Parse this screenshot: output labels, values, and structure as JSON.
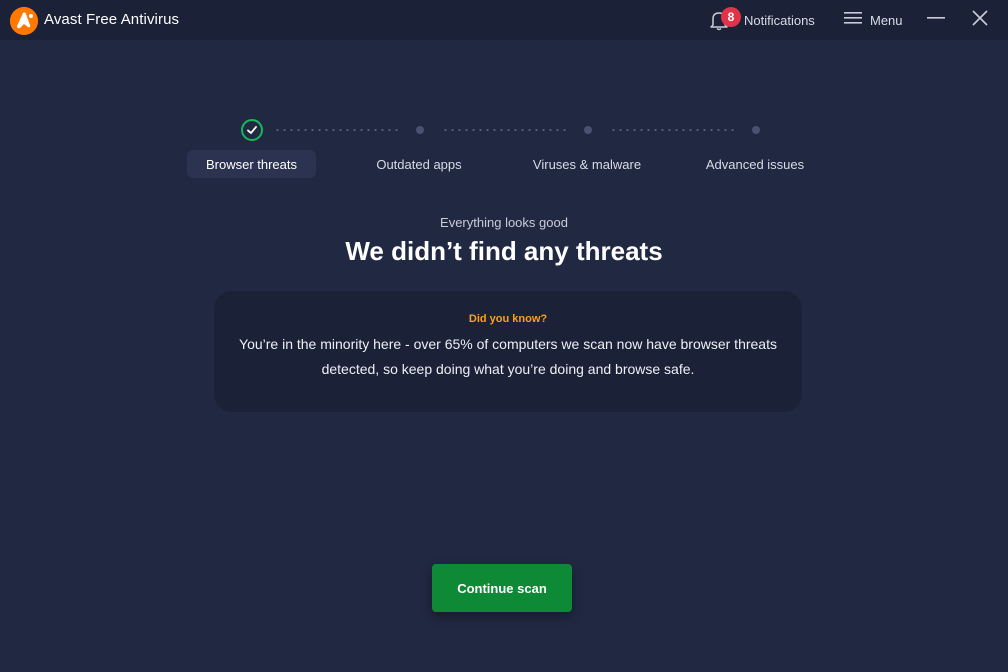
{
  "titlebar": {
    "app_title": "Avast Free Antivirus",
    "notifications_label": "Notifications",
    "notifications_count": "8",
    "menu_label": "Menu"
  },
  "steps": [
    {
      "label": "Browser threats",
      "state": "done"
    },
    {
      "label": "Outdated apps",
      "state": "pending"
    },
    {
      "label": "Viruses & malware",
      "state": "pending"
    },
    {
      "label": "Advanced issues",
      "state": "pending"
    }
  ],
  "result": {
    "subtitle": "Everything looks good",
    "headline": "We didn’t find any threats"
  },
  "tip": {
    "kicker": "Did you know?",
    "body": "You’re in the minority here - over 65% of computers we scan now have browser threats detected, so keep doing what you’re doing and browse safe."
  },
  "actions": {
    "continue_label": "Continue scan"
  },
  "colors": {
    "background": "#212842",
    "titlebar": "#1b2136",
    "accent_orange": "#ff7800",
    "success_green": "#16b65b",
    "button_green": "#0e8a36",
    "badge_red": "#e0334a",
    "tip_kicker": "#ff9f1a"
  },
  "icons": {
    "logo": "avast-logo-icon",
    "bell": "bell-icon",
    "menu": "hamburger-icon",
    "minimize": "minimize-icon",
    "close": "close-icon",
    "step_done": "checkmark-icon"
  }
}
